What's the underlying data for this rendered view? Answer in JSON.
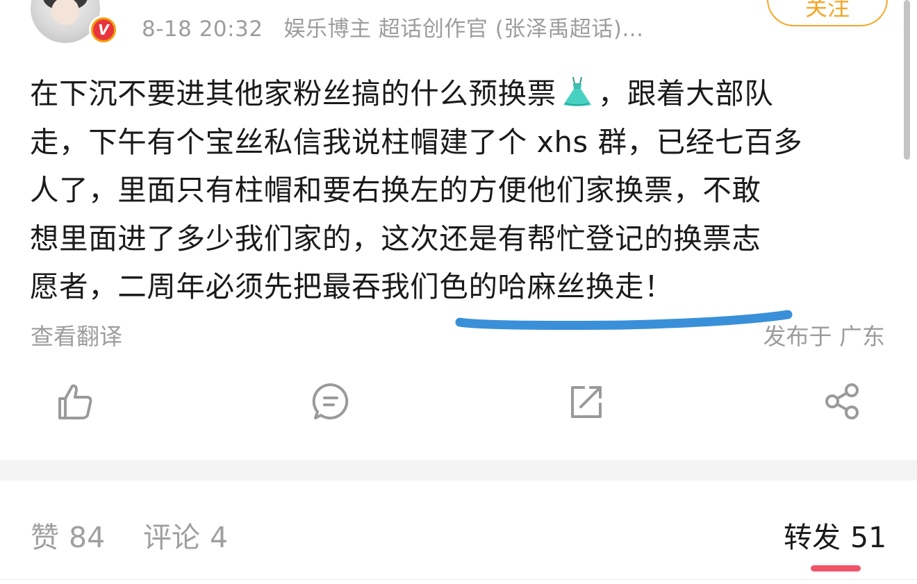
{
  "header": {
    "time": "8-18 20:32",
    "source": "娱乐博主 超话创作官 (张泽禹超话)...",
    "follow_label": "关注",
    "badge_letter": "V"
  },
  "post": {
    "line1_before": "在下沉不要进其他家粉丝搞的什么预换票",
    "line1_emoji": "dress-icon",
    "line1_after": "，跟着大部队",
    "line2": "走，下午有个宝丝私信我说柱帽建了个 xhs 群，已经七百多",
    "line3": "人了，里面只有柱帽和要右换左的方便他们家换票，不敢",
    "line4": "想里面进了多少我们家的，这次还是有帮忙登记的换票志",
    "line5": "愿者，二周年必须先把最吞我们色的哈麻丝换走！",
    "translate_label": "查看翻译",
    "location": "发布于 广东"
  },
  "actions": {
    "like_icon": "thumbs-up-icon",
    "comment_icon": "comment-icon",
    "repost_icon": "repost-icon",
    "share_icon": "share-icon"
  },
  "tabs": {
    "likes_label": "赞",
    "likes_count": "84",
    "comments_label": "评论",
    "comments_count": "4",
    "reposts_label": "转发",
    "reposts_count": "51"
  },
  "colors": {
    "accent_follow": "#f5a623",
    "active_indicator": "#f0566a",
    "annotation_stroke": "#3a8fd9",
    "meta_gray": "#9d9d9d"
  }
}
